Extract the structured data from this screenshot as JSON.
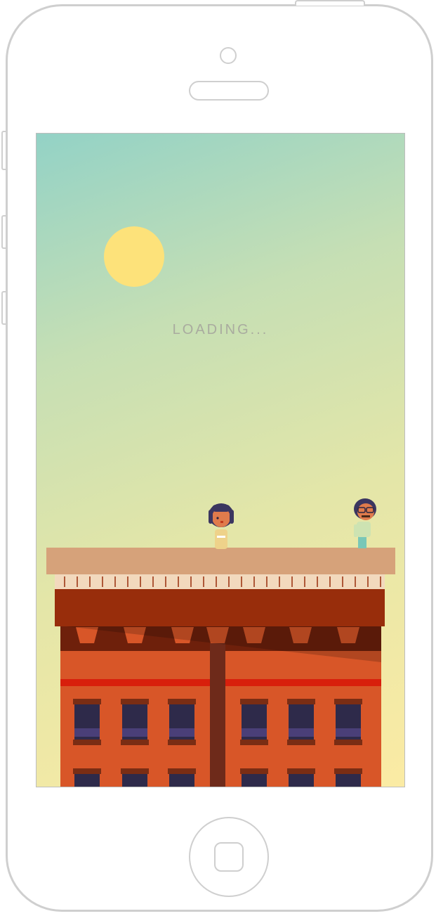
{
  "game": {
    "status_text": "LOADING..."
  },
  "palette": {
    "sky_top": "#93d2c6",
    "sky_bottom": "#fbeba4",
    "sun": "#fde27a",
    "roof_top": "#d6a27a",
    "cornice": "#982d0b",
    "facade": "#d85628",
    "stripe": "#d81f0c",
    "pillar": "#6e2a1a",
    "window": "#2e2a4a"
  },
  "characters": [
    {
      "name": "girl",
      "role": "player"
    },
    {
      "name": "man",
      "role": "npc"
    }
  ]
}
